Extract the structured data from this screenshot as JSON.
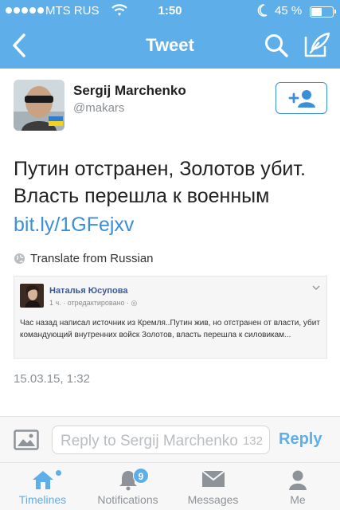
{
  "status_bar": {
    "carrier": "MTS RUS",
    "time": "1:50",
    "battery_percent": "45 %"
  },
  "nav": {
    "title": "Tweet"
  },
  "tweet": {
    "author_name": "Sergij Marchenko",
    "author_handle": "@makars",
    "text": "Путин отстранен, Золотов убит. Власть перешла к военным",
    "link": "bit.ly/1GFejxv",
    "translate_label": "Translate from Russian",
    "timestamp": "15.03.15, 1:32"
  },
  "embedded_post": {
    "author": "Наталья Юсупова",
    "meta": "1 ч. · отредактировано · ◎",
    "text": "Час назад написал источник из Кремля..Путин жив, но отстранен от власти, убит командующий внутренних войск Золотов, власть перешла к силовикам..."
  },
  "reply": {
    "placeholder": "Reply to Sergij Marchenko",
    "char_count": "132",
    "button_label": "Reply"
  },
  "tabs": [
    {
      "label": "Timelines",
      "icon": "home-icon",
      "active": true
    },
    {
      "label": "Notifications",
      "icon": "bell-icon",
      "badge": "9"
    },
    {
      "label": "Messages",
      "icon": "envelope-icon"
    },
    {
      "label": "Me",
      "icon": "person-icon"
    }
  ],
  "colors": {
    "header_bg": "#5eaeea",
    "accent": "#3a8fd8",
    "muted": "#8a8f94"
  }
}
